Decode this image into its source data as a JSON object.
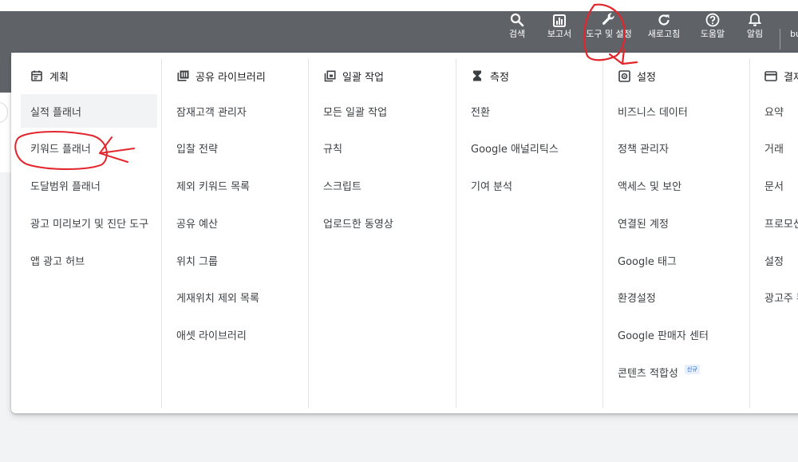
{
  "topbar": {
    "items": [
      {
        "label": "검색",
        "icon": "search-icon"
      },
      {
        "label": "보고서",
        "icon": "bar-chart-icon"
      },
      {
        "label": "도구 및 설정",
        "icon": "wrench-icon"
      },
      {
        "label": "새로고침",
        "icon": "refresh-icon"
      },
      {
        "label": "도움말",
        "icon": "help-icon"
      },
      {
        "label": "알림",
        "icon": "bell-icon"
      }
    ],
    "account": "bu"
  },
  "menu": {
    "columns": [
      {
        "title": "계획",
        "icon": "calendar-icon",
        "items": [
          "실적 플래너",
          "키워드 플래너",
          "도달범위 플래너",
          "광고 미리보기 및 진단 도구",
          "앱 광고 허브"
        ]
      },
      {
        "title": "공유 라이브러리",
        "icon": "library-icon",
        "items": [
          "잠재고객 관리자",
          "입찰 전략",
          "제외 키워드 목록",
          "공유 예산",
          "위치 그룹",
          "게재위치 제외 목록",
          "애셋 라이브러리"
        ]
      },
      {
        "title": "일괄 작업",
        "icon": "copy-icon",
        "items": [
          "모든 일괄 작업",
          "규칙",
          "스크립트",
          "업로드한 동영상"
        ]
      },
      {
        "title": "측정",
        "icon": "hourglass-icon",
        "items": [
          "전환",
          "Google 애널리틱스",
          "기여 분석"
        ]
      },
      {
        "title": "설정",
        "icon": "settings-icon",
        "items": [
          "비즈니스 데이터",
          "정책 관리자",
          "액세스 및 보안",
          "연결된 계정",
          "Google 태그",
          "환경설정",
          "Google 판매자 센터",
          "콘텐츠 적합성"
        ],
        "badge": "신규"
      },
      {
        "title": "결제",
        "icon": "credit-card-icon",
        "items": [
          "요약",
          "거래",
          "문서",
          "프로모션",
          "설정",
          "광고주 확"
        ]
      }
    ]
  },
  "colors": {
    "topbar": "#5f6368",
    "annotation": "#e3262d",
    "active_item": "#f1f3f4",
    "badge_text": "#1967d2"
  }
}
